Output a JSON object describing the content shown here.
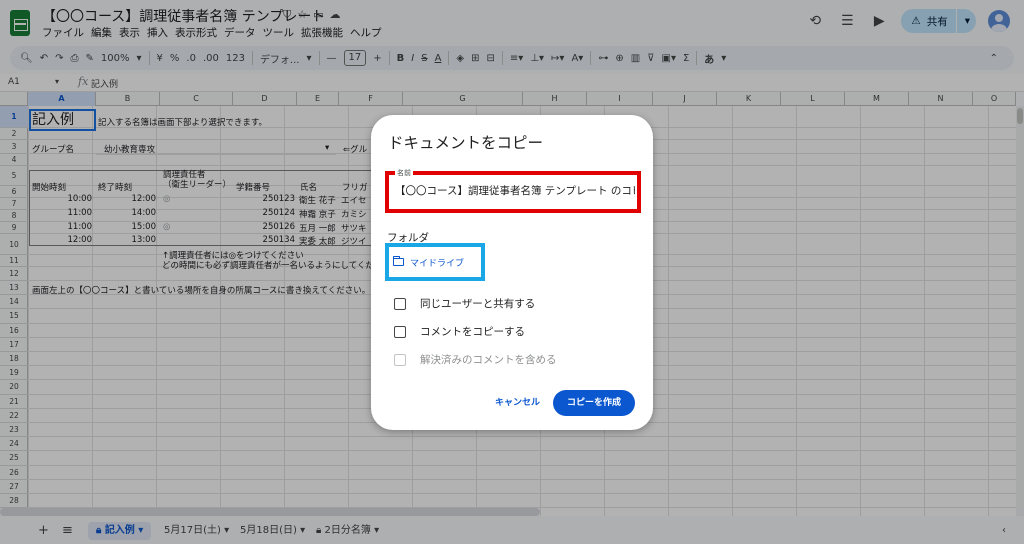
{
  "app": {
    "title": "【〇〇コース】調理従事者名簿 テンプレート",
    "menu": [
      "ファイル",
      "編集",
      "表示",
      "挿入",
      "表示形式",
      "データ",
      "ツール",
      "拡張機能",
      "ヘルプ"
    ],
    "share_label": "共有"
  },
  "toolbar": {
    "zoom": "100%",
    "currency": "¥",
    "percent": "%",
    "dec_minus": ".0",
    "dec_plus": ".00",
    "num_format": "123",
    "font": "デフォ...",
    "font_size": "17",
    "bold": "B",
    "italic": "I",
    "strike": "S",
    "color": "A",
    "ime": "あ"
  },
  "formula": {
    "cell_ref": "A1",
    "fx": "fx",
    "content": "記入例"
  },
  "grid": {
    "columns": [
      "A",
      "B",
      "C",
      "D",
      "E",
      "F",
      "G",
      "H",
      "I",
      "J",
      "K",
      "L",
      "M",
      "N",
      "O"
    ],
    "rows": [
      "1",
      "2",
      "3",
      "4",
      "5",
      "6",
      "7",
      "8",
      "9",
      "10",
      "11",
      "12",
      "13",
      "14",
      "15",
      "16",
      "17",
      "18",
      "19",
      "20",
      "21",
      "22",
      "23",
      "24",
      "25",
      "26",
      "27",
      "28"
    ],
    "a1": "記入例",
    "b1": "記入する名簿は画面下部より選択できます。",
    "a3": "グループ名",
    "b3": "幼小教育専攻",
    "f3": "⇐グル",
    "c5_line1": "調理責任者",
    "c5_line2": "（衛生リーダー）",
    "headers": [
      "開始時刻",
      "終了時刻",
      "",
      "学籍番号",
      "氏名",
      "フリガ"
    ],
    "table": [
      {
        "start": "10:00",
        "end": "12:00",
        "leader": "◎",
        "id": "250123",
        "name": "衛生 花子",
        "kana": "エイセ"
      },
      {
        "start": "11:00",
        "end": "14:00",
        "leader": "",
        "id": "250124",
        "name": "神霜 京子",
        "kana": "カミシ"
      },
      {
        "start": "11:00",
        "end": "15:00",
        "leader": "◎",
        "id": "250126",
        "name": "五月 一郎",
        "kana": "サツキ"
      },
      {
        "start": "12:00",
        "end": "13:00",
        "leader": "",
        "id": "250134",
        "name": "実委 太郎",
        "kana": "ジツイ"
      }
    ],
    "note1": "↑調理責任者には◎をつけてください",
    "note2": "どの時間にも必ず調理責任者が一名いるようにしてくだ",
    "row12": "画面左上の【〇〇コース】と書いている場所を自身の所属コースに書き換えてください。"
  },
  "sheets": {
    "add": "+",
    "list": "≡",
    "tabs": [
      "記入例",
      "5月17日(土)",
      "5月18日(日)",
      "2日分名簿"
    ]
  },
  "dialog": {
    "title": "ドキュメントをコピー",
    "name_label": "名前",
    "name_value": "【〇〇コース】調理従事者名簿 テンプレート のコピー",
    "folder_label": "フォルダ",
    "folder_value": "マイドライブ",
    "options": [
      "同じユーザーと共有する",
      "コメントをコピーする",
      "解決済みのコメントを含める"
    ],
    "cancel": "キャンセル",
    "create": "コピーを作成"
  }
}
